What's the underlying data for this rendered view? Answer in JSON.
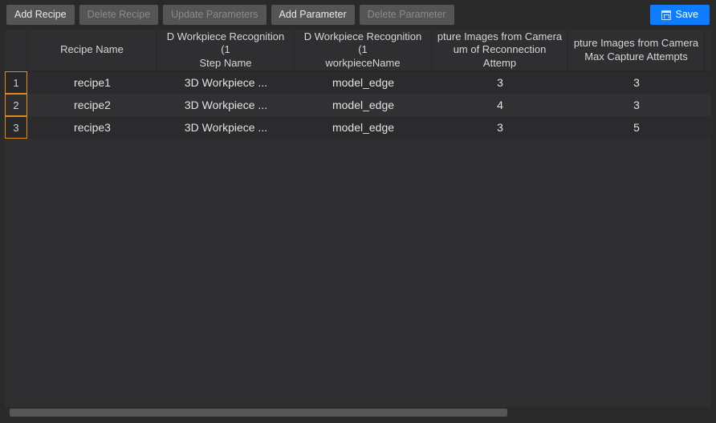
{
  "toolbar": {
    "addRecipe": "Add Recipe",
    "deleteRecipe": "Delete Recipe",
    "updateParameters": "Update Parameters",
    "addParameter": "Add Parameter",
    "deleteParameter": "Delete Parameter",
    "save": "Save"
  },
  "table": {
    "headers": {
      "recipeName": "Recipe Name",
      "stepName": "D Workpiece Recognition (1\nStep Name",
      "workpieceName": "D Workpiece Recognition (1\nworkpieceName",
      "reconnection": "pture Images from Camera\num of Reconnection Attemp",
      "maxCapture": "pture Images from Camera\nMax Capture Attempts"
    },
    "rowNumbers": [
      "1",
      "2",
      "3"
    ],
    "rows": [
      {
        "name": "recipe1",
        "step": "3D Workpiece ...",
        "wp": "model_edge",
        "reconn": "3",
        "max": "3"
      },
      {
        "name": "recipe2",
        "step": "3D Workpiece ...",
        "wp": "model_edge",
        "reconn": "4",
        "max": "3"
      },
      {
        "name": "recipe3",
        "step": "3D Workpiece ...",
        "wp": "model_edge",
        "reconn": "3",
        "max": "5"
      }
    ]
  }
}
